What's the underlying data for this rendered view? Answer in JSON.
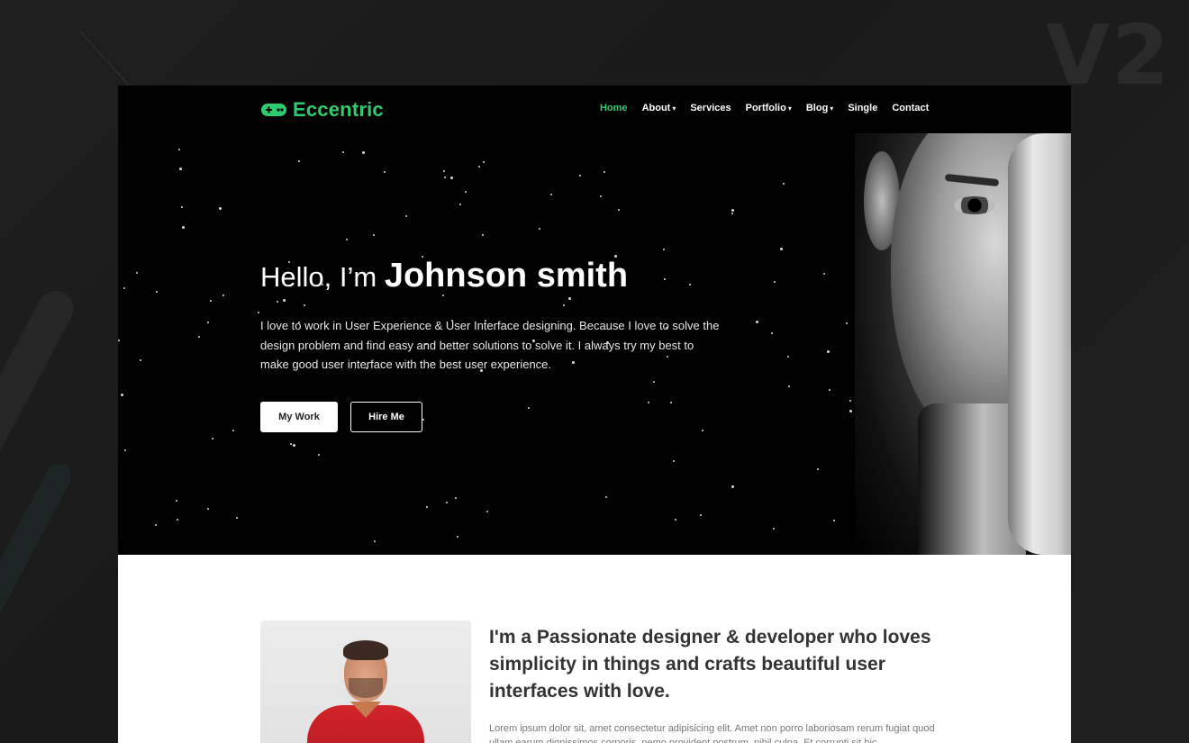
{
  "badge": "V2",
  "brand": {
    "name": "Eccentric",
    "icon": "gamepad-icon",
    "color": "#2ecc71"
  },
  "nav": {
    "items": [
      {
        "label": "Home",
        "active": true,
        "dropdown": false
      },
      {
        "label": "About",
        "active": false,
        "dropdown": true
      },
      {
        "label": "Services",
        "active": false,
        "dropdown": false
      },
      {
        "label": "Portfolio",
        "active": false,
        "dropdown": true
      },
      {
        "label": "Blog",
        "active": false,
        "dropdown": true
      },
      {
        "label": "Single",
        "active": false,
        "dropdown": false
      },
      {
        "label": "Contact",
        "active": false,
        "dropdown": false
      }
    ]
  },
  "hero": {
    "greeting": "Hello, I’m ",
    "name": "Johnson smith",
    "description": "I love to work in User Experience & User Interface designing. Because I love to solve the design problem and find easy and better solutions to solve it. I always try my best to make good user interface with the best user experience.",
    "primary_button": "My Work",
    "secondary_button": "Hire Me"
  },
  "about": {
    "heading": "I'm a Passionate designer & developer who loves simplicity in things and crafts beautiful user interfaces with love.",
    "text": "Lorem ipsum dolor sit, amet consectetur adipisicing elit. Amet non porro laboriosam rerum fugiat quod ullam earum dignissimos corporis, nemo provident postrum, nihil culpa. Et corrupti sit hic"
  }
}
